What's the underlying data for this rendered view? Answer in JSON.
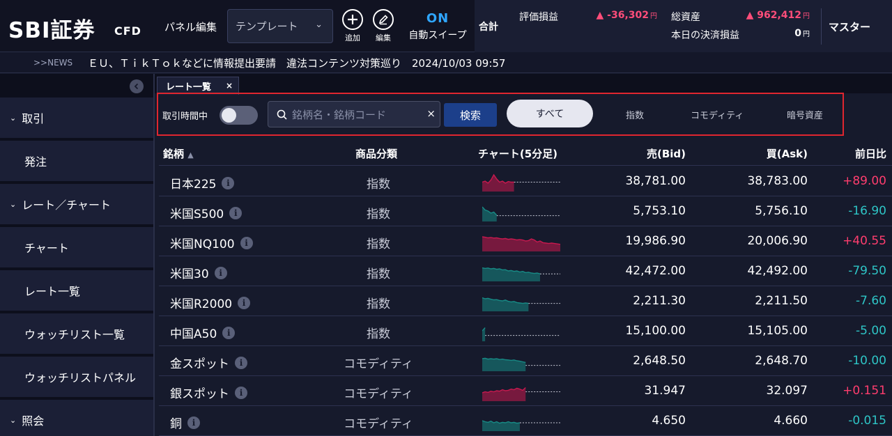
{
  "header": {
    "logo": "SBI証券",
    "logo_sub": "CFD",
    "panel_edit": "パネル編集",
    "template": "テンプレート",
    "add_label": "追加",
    "edit_label": "編集",
    "auto_sweep_state": "ON",
    "auto_sweep_label": "自動スイープ"
  },
  "summary": {
    "total_label": "合計",
    "pl_label": "評価損益",
    "pl_value": "▲ -36,302",
    "assets_label": "総資産",
    "assets_value": "▲ 962,412",
    "settle_label": "本日の決済損益",
    "settle_value": "0",
    "currency": "円",
    "master": "マスター"
  },
  "news": {
    "tag": ">>NEWS",
    "text": "ＥＵ、ＴｉｋＴｏｋなどに情報提出要請　違法コンテンツ対策巡り　2024/10/03 09:57"
  },
  "sidebar": {
    "items": [
      {
        "label": "取引",
        "group": true
      },
      {
        "label": "発注",
        "group": false
      },
      {
        "label": "レート／チャート",
        "group": true
      },
      {
        "label": "チャート",
        "group": false
      },
      {
        "label": "レート一覧",
        "group": false
      },
      {
        "label": "ウォッチリスト一覧",
        "group": false
      },
      {
        "label": "ウォッチリストパネル",
        "group": false
      },
      {
        "label": "照会",
        "group": true
      }
    ]
  },
  "tab": {
    "label": "レート一覧",
    "close": "×"
  },
  "filter": {
    "trading_label": "取引時間中",
    "search_placeholder": "銘柄名・銘柄コード",
    "search_button": "検索",
    "clear": "×",
    "categories": [
      "すべて",
      "指数",
      "コモディティ",
      "暗号資産"
    ]
  },
  "table": {
    "columns": {
      "name": "銘柄",
      "category": "商品分類",
      "chart": "チャート(5分足)",
      "bid": "売(Bid)",
      "ask": "買(Ask)",
      "change": "前日比"
    },
    "rows": [
      {
        "name": "日本225",
        "category": "指数",
        "bid": "38,781.00",
        "ask": "38,783.00",
        "change": "+89.00",
        "dir": "up",
        "spark": [
          0.55,
          0.5,
          0.6,
          0.45,
          0.2,
          0.4,
          0.55,
          0.5,
          0.6,
          0.52,
          0.55,
          0.55,
          0.55,
          0.55,
          0.55,
          0.55,
          0.55,
          0.55,
          0.55,
          0.55,
          0.55,
          0.55,
          0.55,
          0.55,
          0.55,
          0.55,
          0.55,
          0.55
        ],
        "filled": 12
      },
      {
        "name": "米国S500",
        "category": "指数",
        "bid": "5,753.10",
        "ask": "5,756.10",
        "change": "-16.90",
        "dir": "down",
        "spark": [
          0.3,
          0.45,
          0.5,
          0.6,
          0.55,
          0.7,
          0.65,
          0.72,
          0.72,
          0.72,
          0.72,
          0.72,
          0.72,
          0.72,
          0.72,
          0.72,
          0.72,
          0.72,
          0.72,
          0.72,
          0.72,
          0.72,
          0.72,
          0.72,
          0.72,
          0.72,
          0.72,
          0.72
        ],
        "filled": 6
      },
      {
        "name": "米国NQ100",
        "category": "指数",
        "bid": "19,986.90",
        "ask": "20,006.90",
        "change": "+40.55",
        "dir": "up",
        "spark": [
          0.3,
          0.32,
          0.35,
          0.33,
          0.36,
          0.35,
          0.38,
          0.4,
          0.38,
          0.42,
          0.4,
          0.42,
          0.45,
          0.43,
          0.45,
          0.5,
          0.48,
          0.4,
          0.45,
          0.55,
          0.5,
          0.58,
          0.6,
          0.62,
          0.6,
          0.62,
          0.64,
          0.66
        ],
        "filled": 28
      },
      {
        "name": "米国30",
        "category": "指数",
        "bid": "42,472.00",
        "ask": "42,492.00",
        "change": "-79.50",
        "dir": "down",
        "spark": [
          0.35,
          0.38,
          0.36,
          0.4,
          0.38,
          0.42,
          0.4,
          0.45,
          0.44,
          0.5,
          0.48,
          0.52,
          0.5,
          0.55,
          0.52,
          0.58,
          0.56,
          0.6,
          0.62,
          0.6,
          0.64,
          0.62,
          0.64,
          0.64,
          0.64,
          0.64,
          0.64,
          0.64
        ],
        "filled": 21
      },
      {
        "name": "米国R2000",
        "category": "指数",
        "bid": "2,211.30",
        "ask": "2,211.50",
        "change": "-7.60",
        "dir": "down",
        "spark": [
          0.35,
          0.4,
          0.38,
          0.42,
          0.45,
          0.44,
          0.48,
          0.5,
          0.46,
          0.52,
          0.55,
          0.53,
          0.58,
          0.6,
          0.62,
          0.6,
          0.62,
          0.62,
          0.62,
          0.62,
          0.62,
          0.62,
          0.62,
          0.62,
          0.62,
          0.62,
          0.62,
          0.62
        ],
        "filled": 17
      },
      {
        "name": "中国A50",
        "category": "指数",
        "bid": "15,100.00",
        "ask": "15,105.00",
        "change": "-5.00",
        "dir": "down",
        "spark": [
          0.5,
          0.35,
          0.72,
          0.72,
          0.72,
          0.72,
          0.72,
          0.72,
          0.72,
          0.72,
          0.72,
          0.72,
          0.72,
          0.72,
          0.72,
          0.72,
          0.72,
          0.72,
          0.72,
          0.72,
          0.72,
          0.72,
          0.72,
          0.72,
          0.72,
          0.72,
          0.72,
          0.72
        ],
        "filled": 2
      },
      {
        "name": "金スポット",
        "category": "コモディティ",
        "bid": "2,648.50",
        "ask": "2,648.70",
        "change": "-10.00",
        "dir": "down",
        "spark": [
          0.4,
          0.38,
          0.42,
          0.4,
          0.42,
          0.4,
          0.44,
          0.42,
          0.45,
          0.46,
          0.48,
          0.46,
          0.5,
          0.52,
          0.55,
          0.58,
          0.6,
          0.62,
          0.65,
          0.68,
          0.7,
          0.72,
          0.72,
          0.72,
          0.72,
          0.72,
          0.72,
          0.72
        ],
        "filled": 16
      },
      {
        "name": "銀スポット",
        "category": "コモディティ",
        "bid": "31.947",
        "ask": "32.097",
        "change": "+0.151",
        "dir": "up",
        "spark": [
          0.6,
          0.55,
          0.58,
          0.52,
          0.55,
          0.5,
          0.52,
          0.45,
          0.5,
          0.48,
          0.42,
          0.45,
          0.38,
          0.42,
          0.48,
          0.35,
          0.5,
          0.55,
          0.3,
          0.55,
          0.55,
          0.55,
          0.55,
          0.55,
          0.55,
          0.55,
          0.55,
          0.55
        ],
        "filled": 16
      },
      {
        "name": "銅",
        "category": "コモディティ",
        "bid": "4.650",
        "ask": "4.660",
        "change": "-0.015",
        "dir": "down",
        "spark": [
          0.5,
          0.55,
          0.58,
          0.52,
          0.6,
          0.55,
          0.62,
          0.58,
          0.6,
          0.55,
          0.6,
          0.58,
          0.62,
          0.6,
          0.62,
          0.6,
          0.62,
          0.6,
          0.62,
          0.6,
          0.62,
          0.6,
          0.62,
          0.6,
          0.62,
          0.6,
          0.62,
          0.6
        ],
        "filled": 14
      }
    ]
  },
  "colors": {
    "up": "#ff3d6e",
    "down": "#2ec5c6",
    "up_spark": "#c8194f",
    "down_spark": "#178a85",
    "accent": "#2fa6ff",
    "highlight_border": "#e0262f"
  }
}
